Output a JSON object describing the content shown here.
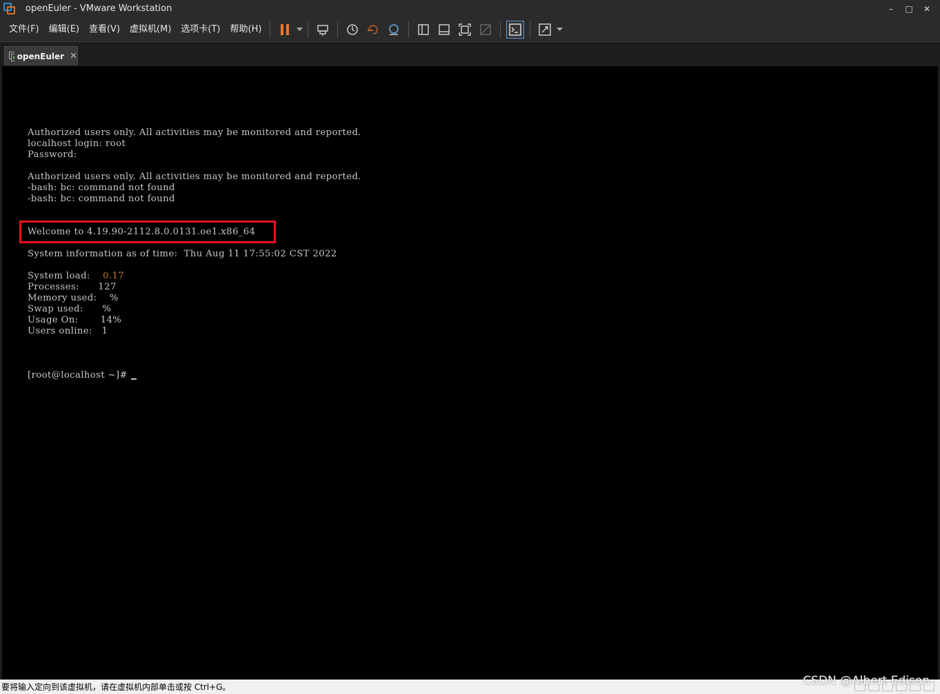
{
  "window": {
    "title": "openEuler - VMware Workstation",
    "minimize_glyph": "–",
    "maximize_glyph": "□",
    "close_glyph": "✕"
  },
  "menu": {
    "items": [
      {
        "label": "文件(F)"
      },
      {
        "label": "编辑(E)"
      },
      {
        "label": "查看(V)"
      },
      {
        "label": "虚拟机(M)"
      },
      {
        "label": "选项卡(T)"
      },
      {
        "label": "帮助(H)"
      }
    ]
  },
  "toolbar": {
    "icons": [
      "pause-icon",
      "dropdown-arrow-icon",
      "send-ctrl-alt-del-icon",
      "snapshot-icon",
      "revert-snapshot-icon",
      "snapshot-manager-icon",
      "sidebar-view-icon",
      "thumbnail-bar-icon",
      "full-screen-icon",
      "unity-icon",
      "console-view-icon",
      "stretch-guest-icon",
      "dropdown-arrow-icon"
    ],
    "pause_color": "#f07828",
    "active_icon": "console-view-icon"
  },
  "tab": {
    "label": "openEuler",
    "close_glyph": "✕"
  },
  "console": {
    "lines": [
      "Authorized users only. All activities may be monitored and reported.",
      "localhost login: root",
      "Password:",
      "",
      "Authorized users only. All activities may be monitored and reported.",
      "-bash: bc: command not found",
      "-bash: bc: command not found",
      "",
      "",
      "Welcome to 4.19.90-2112.8.0.0131.oe1.x86_64",
      "",
      "System information as of time:  Thu Aug 11 17:55:02 CST 2022",
      ""
    ],
    "sysinfo": [
      {
        "key": "System load:    ",
        "value": "0.17",
        "highlight": true
      },
      {
        "key": "Processes:      ",
        "value": "127"
      },
      {
        "key": "Memory used:    ",
        "value": "%"
      },
      {
        "key": "Swap used:      ",
        "value": "%"
      },
      {
        "key": "Usage On:       ",
        "value": "14%"
      },
      {
        "key": "Users online:   ",
        "value": "1"
      }
    ],
    "prompt": "[root@localhost ~]# ",
    "highlight_color": "#e8141b",
    "value_highlight_color": "#c87a20"
  },
  "statusbar": {
    "text": "要将输入定向到该虚拟机，请在虚拟机内部单击或按 Ctrl+G。"
  },
  "watermark": "CSDN @Albert Edison"
}
